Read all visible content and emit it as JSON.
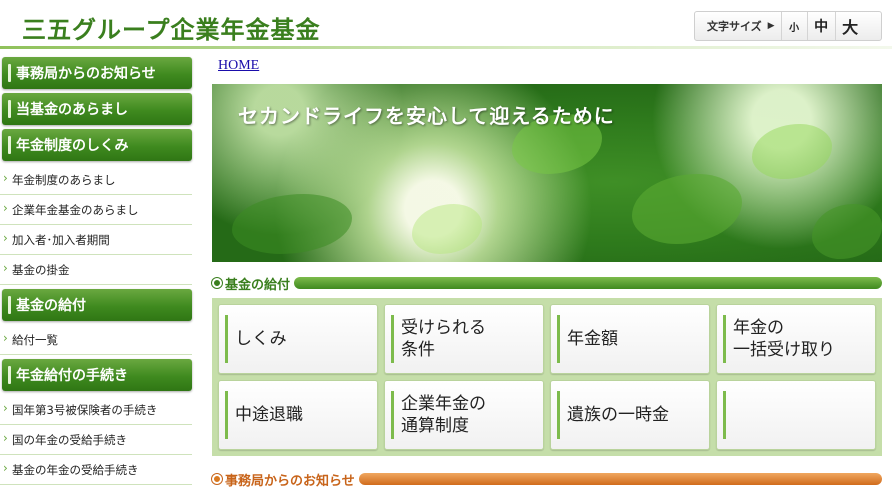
{
  "header": {
    "site_title": "三五グループ企業年金基金",
    "font_size": {
      "label": "文字サイズ",
      "arrow": "▶",
      "small": "小",
      "medium": "中",
      "large": "大"
    }
  },
  "sidebar": {
    "sections": [
      {
        "heading": "事務局からのお知らせ",
        "links": []
      },
      {
        "heading": "当基金のあらまし",
        "links": []
      },
      {
        "heading": "年金制度のしくみ",
        "links": [
          "年金制度のあらまし",
          "企業年金基金のあらまし",
          "加入者･加入者期間",
          "基金の掛金"
        ]
      },
      {
        "heading": "基金の給付",
        "links": [
          "給付一覧"
        ]
      },
      {
        "heading": "年金給付の手続き",
        "links": [
          "国年第3号被保険者の手続き",
          "国の年金の受給手続き",
          "基金の年金の受給手続き"
        ]
      }
    ]
  },
  "breadcrumb": {
    "home": "HOME"
  },
  "hero": {
    "text": "セカンドライフを安心して迎えるために"
  },
  "sections": {
    "benefits_title": "基金の給付",
    "news_title": "事務局からのお知らせ"
  },
  "benefit_tiles": [
    "しくみ",
    "受けられる\n条件",
    "年金額",
    "年金の\n一括受け取り",
    "中途退職",
    "企業年金の\n通算制度",
    "遺族の一時金",
    ""
  ],
  "colors": {
    "brand_green": "#3a7f1e",
    "nav_green": "#3f8a1f",
    "panel_green": "#c5dea9",
    "news_orange": "#d06c1c",
    "link_blue": "#1a0dab"
  }
}
